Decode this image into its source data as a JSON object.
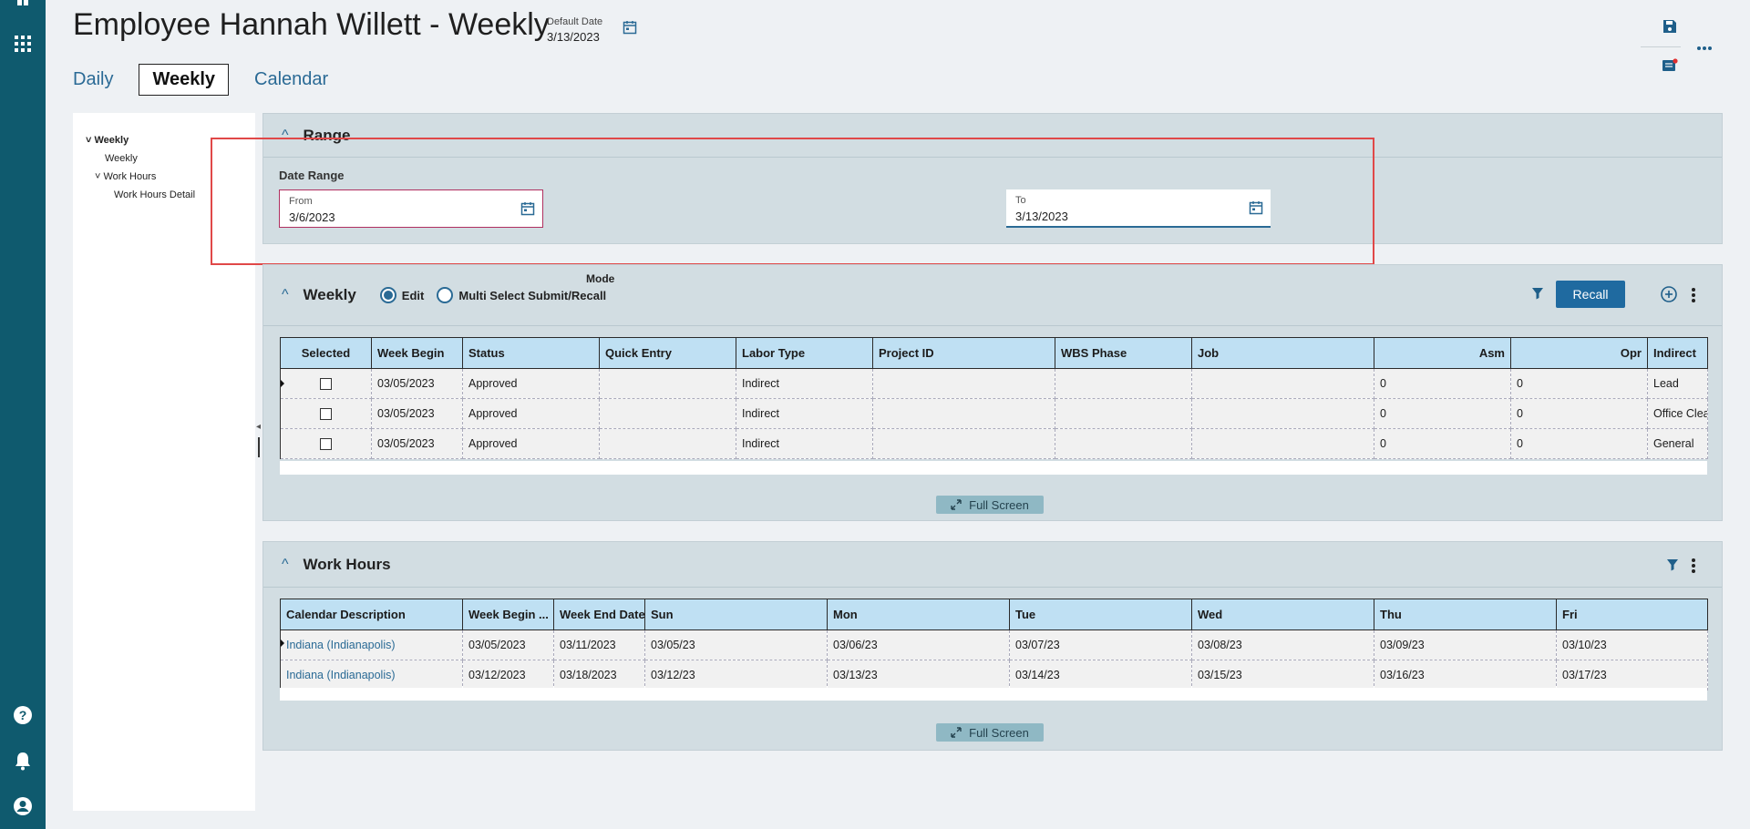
{
  "header": {
    "title": "Employee Hannah Willett - Weekly",
    "default_date_label": "Default Date",
    "default_date_value": "3/13/2023"
  },
  "tabs": [
    {
      "label": "Daily"
    },
    {
      "label": "Weekly",
      "active": true
    },
    {
      "label": "Calendar"
    }
  ],
  "tree": {
    "root": "Weekly",
    "child1": "Weekly",
    "child2": "Work Hours",
    "child3": "Work Hours Detail"
  },
  "range": {
    "title": "Range",
    "section_label": "Date Range",
    "from_label": "From",
    "from_value": "3/6/2023",
    "to_label": "To",
    "to_value": "3/13/2023"
  },
  "weekly": {
    "title": "Weekly",
    "mode_label": "Mode",
    "mode_edit": "Edit",
    "mode_multi": "Multi Select Submit/Recall",
    "recall_label": "Recall",
    "full_screen_label": "Full Screen",
    "columns": [
      "Selected",
      "Week Begin",
      "Status",
      "Quick Entry",
      "Labor Type",
      "Project ID",
      "WBS Phase",
      "Job",
      "Asm",
      "Opr",
      "Indirect"
    ],
    "rows": [
      {
        "week_begin": "03/05/2023",
        "status": "Approved",
        "quick_entry": "",
        "labor_type": "Indirect",
        "project_id": "",
        "wbs_phase": "",
        "job": "",
        "asm": "0",
        "opr": "0",
        "indirect": "Lead"
      },
      {
        "week_begin": "03/05/2023",
        "status": "Approved",
        "quick_entry": "",
        "labor_type": "Indirect",
        "project_id": "",
        "wbs_phase": "",
        "job": "",
        "asm": "0",
        "opr": "0",
        "indirect": "Office Clea"
      },
      {
        "week_begin": "03/05/2023",
        "status": "Approved",
        "quick_entry": "",
        "labor_type": "Indirect",
        "project_id": "",
        "wbs_phase": "",
        "job": "",
        "asm": "0",
        "opr": "0",
        "indirect": "General"
      }
    ]
  },
  "work_hours": {
    "title": "Work Hours",
    "full_screen_label": "Full Screen",
    "columns": [
      "Calendar Description",
      "Week Begin ...",
      "Week End Date",
      "Sun",
      "Mon",
      "Tue",
      "Wed",
      "Thu",
      "Fri"
    ],
    "rows": [
      {
        "desc": "Indiana (Indianapolis)",
        "week_begin": "03/05/2023",
        "week_end": "03/11/2023",
        "sun": "03/05/23",
        "mon": "03/06/23",
        "tue": "03/07/23",
        "wed": "03/08/23",
        "thu": "03/09/23",
        "fri": "03/10/23"
      },
      {
        "desc": "Indiana (Indianapolis)",
        "week_begin": "03/12/2023",
        "week_end": "03/18/2023",
        "sun": "03/12/23",
        "mon": "03/13/23",
        "tue": "03/14/23",
        "wed": "03/15/23",
        "thu": "03/16/23",
        "fri": "03/17/23"
      }
    ]
  },
  "colors": {
    "rail": "#0f5a6e",
    "accent": "#2a6a95",
    "panel_bg": "#d2dde2",
    "grid_header": "#bfe0f3",
    "highlight_box": "#e04848"
  }
}
